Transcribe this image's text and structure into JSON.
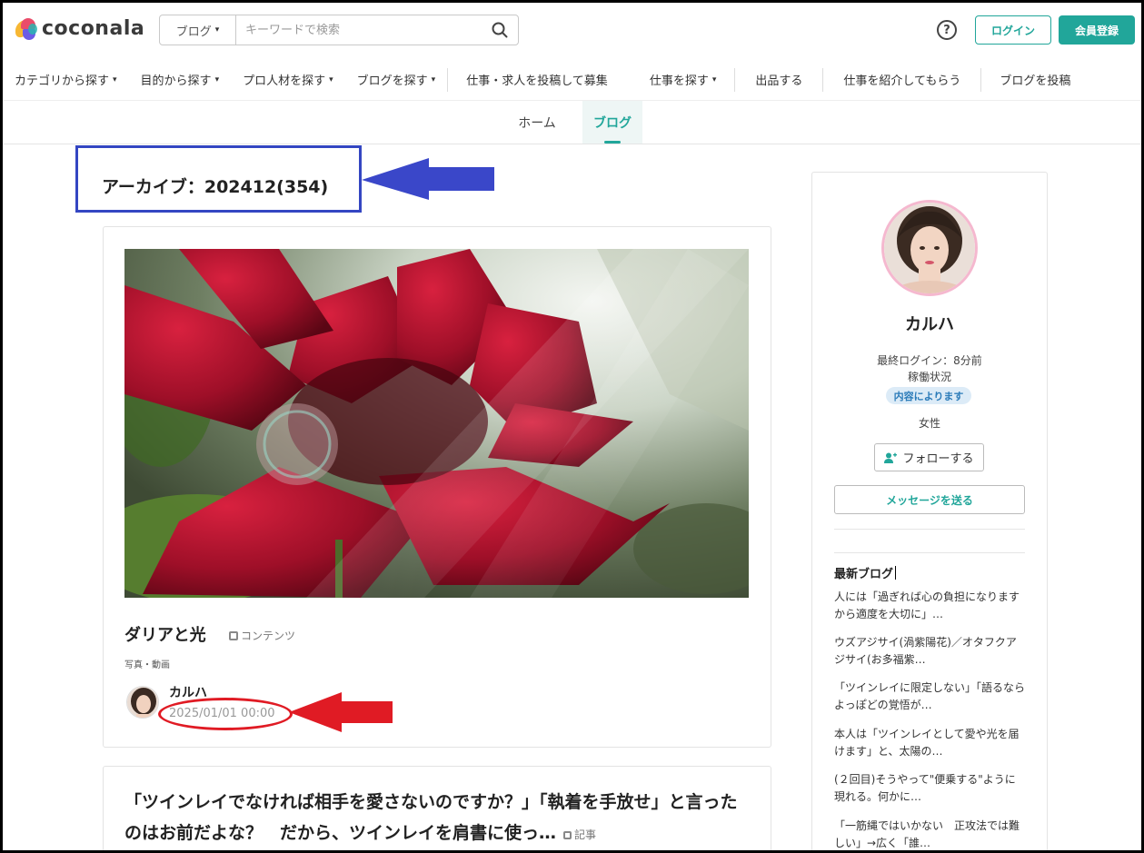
{
  "header": {
    "logo_text": "coconala",
    "search_type": "ブログ",
    "search_placeholder": "キーワードで検索",
    "help_label": "?",
    "login_label": "ログイン",
    "register_label": "会員登録",
    "brand_color": "#21a69a"
  },
  "nav": {
    "items": [
      {
        "label": "カテゴリから探す",
        "dropdown": true
      },
      {
        "label": "目的から探す",
        "dropdown": true
      },
      {
        "label": "プロ人材を探す",
        "dropdown": true
      },
      {
        "label": "ブログを探す",
        "dropdown": true
      },
      {
        "label": "仕事・求人を投稿して募集",
        "dropdown": false
      },
      {
        "label": "仕事を探す",
        "dropdown": true
      },
      {
        "label": "出品する",
        "dropdown": false
      },
      {
        "label": "仕事を紹介してもらう",
        "dropdown": false
      },
      {
        "label": "ブログを投稿",
        "dropdown": false
      }
    ]
  },
  "subnav": {
    "home_label": "ホーム",
    "blog_label": "ブログ"
  },
  "archive": {
    "title": "アーカイブ：202412(354)"
  },
  "posts": [
    {
      "title": "ダリアと光",
      "tag": "コンテンツ",
      "category": "写真・動画",
      "author": "カルハ",
      "date": "2025/01/01 00:00"
    },
    {
      "title": "「ツインレイでなければ相手を愛さないのですか？」「執着を手放せ」と言ったのはお前だよな？　だから、ツインレイを肩書に使っ…",
      "tag": "記事"
    }
  ],
  "sidebar": {
    "name": "カルハ",
    "last_login": "最終ログイン：8分前",
    "work_status_label": "稼働状況",
    "work_status_badge": "内容によります",
    "gender": "女性",
    "follow_label": "フォローする",
    "message_label": "メッセージを送る",
    "latest_title": "最新ブログ",
    "latest_items": [
      "人には「過ぎれば心の負担になりますから適度を大切に」…",
      "ウズアジサイ(渦紫陽花)／オタフクアジサイ(お多福紫…",
      "「ツインレイに限定しない」「語るならよっぽどの覚悟が…",
      "本人は「ツインレイとして愛や光を届けます」と、太陽の…",
      "(２回目)そうやって\"便乗する\"ように現れる。何かに…",
      "「一筋縄ではいかない　正攻法では難しい」→広く「誰…"
    ]
  },
  "annotations": {
    "box_color": "#3446c2",
    "arrow_blue_color": "#3a47c9",
    "arrow_red_color": "#e01b24"
  }
}
